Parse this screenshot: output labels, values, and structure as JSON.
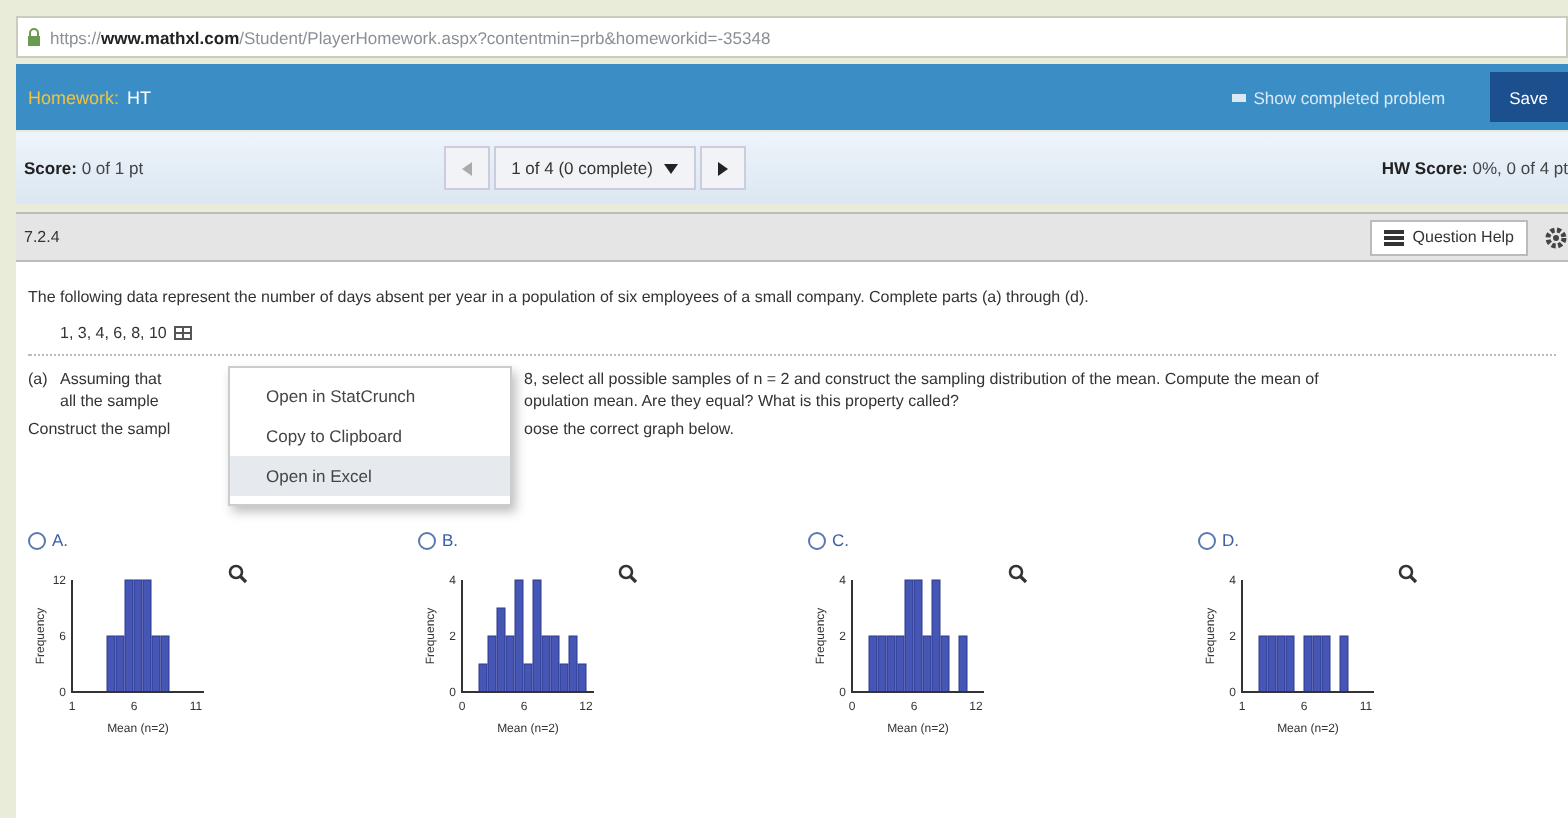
{
  "browser": {
    "url_scheme": "https://",
    "url_host": "www.mathxl.com",
    "url_path": "/Student/PlayerHomework.aspx?contentmin=prb&homeworkid=-35348"
  },
  "header": {
    "label": "Homework:",
    "value": "HT",
    "show_completed": "Show completed problem",
    "save": "Save"
  },
  "score_bar": {
    "score_label": "Score:",
    "score_value": "0 of 1 pt",
    "nav_label": "1 of 4 (0 complete)",
    "hw_label": "HW Score:",
    "hw_value": "0%, 0 of 4 pt"
  },
  "question_bar": {
    "number": "7.2.4",
    "help": "Question Help"
  },
  "question": {
    "intro": "The following data represent the number of days absent per year in a population of six employees of a small company. Complete parts (a) through (d).",
    "data": "1, 3, 4, 6, 8, 10",
    "part_a_marker": "(a)",
    "part_a_line1_left": "Assuming that",
    "part_a_line1_right": "8, select all possible samples of n = 2 and construct the sampling distribution of the mean. Compute the mean of",
    "part_a_line2_left": "all the sample",
    "part_a_line2_right": "opulation mean. Are they equal? What is this property called?",
    "instruction_left": "Construct the sampl",
    "instruction_right": "oose the correct graph below."
  },
  "menu": {
    "items": [
      {
        "label": "Open in StatCrunch",
        "selected": false
      },
      {
        "label": "Copy to Clipboard",
        "selected": false
      },
      {
        "label": "Open in Excel",
        "selected": true
      }
    ]
  },
  "options": [
    {
      "letter": "A.",
      "selected": false,
      "ylabel": "Frequency",
      "xlabel": "Mean (n=2)",
      "yticks": [
        "12",
        "6",
        "0"
      ],
      "xticks": [
        "1",
        "6",
        "11"
      ]
    },
    {
      "letter": "B.",
      "selected": false,
      "ylabel": "Frequency",
      "xlabel": "Mean (n=2)",
      "yticks": [
        "4",
        "2",
        "0"
      ],
      "xticks": [
        "0",
        "6",
        "12"
      ]
    },
    {
      "letter": "C.",
      "selected": false,
      "ylabel": "Frequency",
      "xlabel": "Mean (n=2)",
      "yticks": [
        "4",
        "2",
        "0"
      ],
      "xticks": [
        "0",
        "6",
        "12"
      ]
    },
    {
      "letter": "D.",
      "selected": false,
      "ylabel": "Frequency",
      "xlabel": "Mean (n=2)",
      "yticks": [
        "4",
        "2",
        "0"
      ],
      "xticks": [
        "1",
        "6",
        "11"
      ]
    }
  ]
}
